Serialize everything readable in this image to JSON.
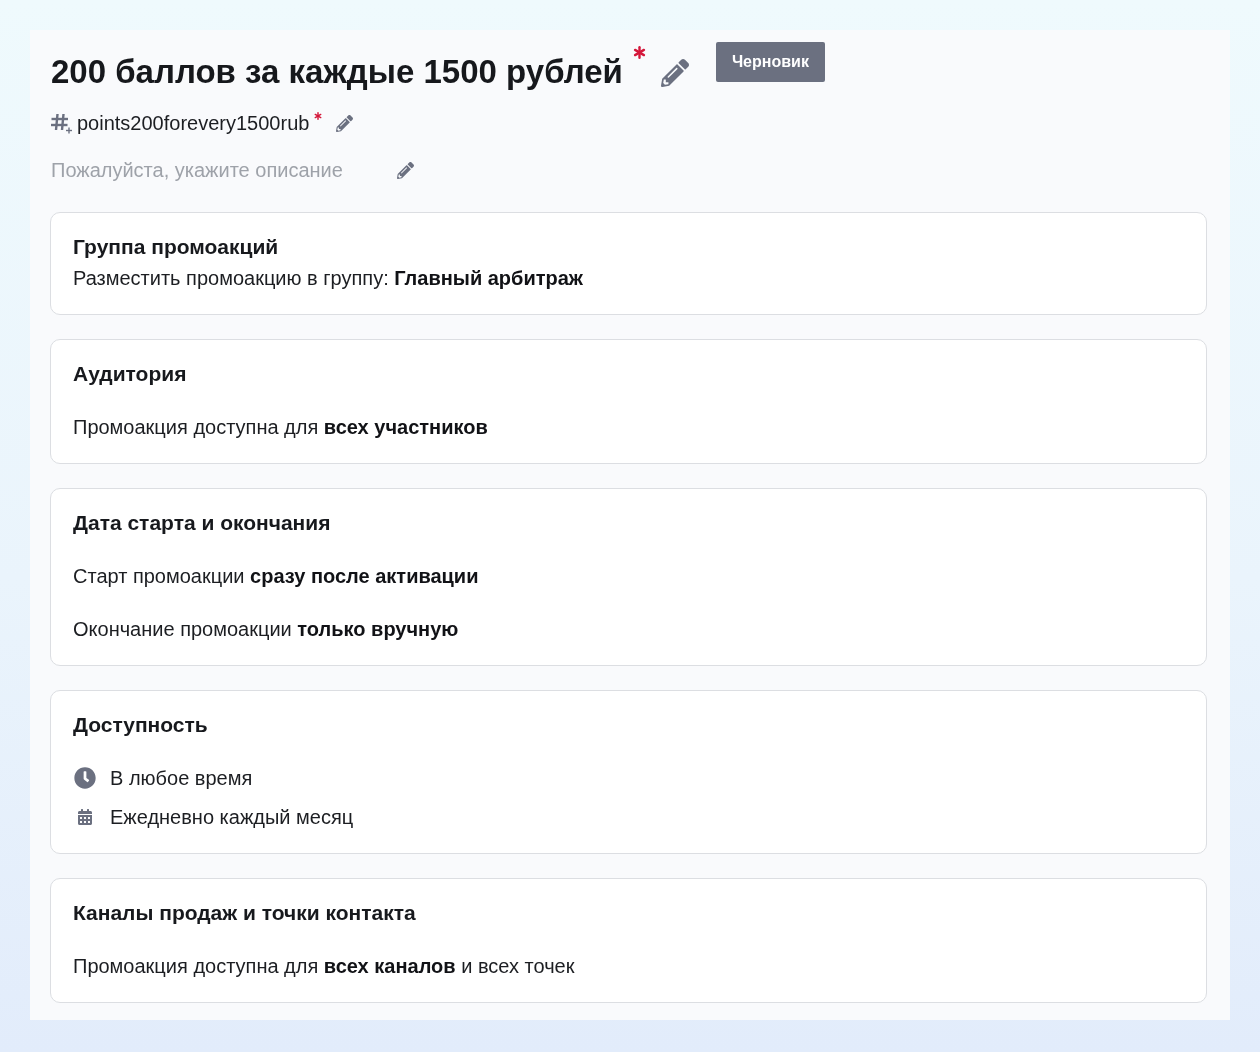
{
  "header": {
    "title": {
      "text": "200 баллов за каждые 1500 рублей",
      "required": true
    },
    "status": "Черновик",
    "code": {
      "text": "points200forevery1500rub",
      "required": true
    },
    "description": {
      "placeholder": "Пожалуйста, укажите описание"
    }
  },
  "sections": [
    {
      "kind": "caption",
      "title": "Группа промоакций",
      "lines": [
        "Разместить промоакцию в группу: **Главный арбитраж**"
      ]
    },
    {
      "kind": "text",
      "title": "Аудитория",
      "lines": [
        "Промоакция доступна для **всех участников**"
      ]
    },
    {
      "kind": "text",
      "title": "Дата старта и окончания",
      "lines": [
        "Старт промоакции **сразу после активации**",
        "Окончание промоакции **только вручную**"
      ]
    },
    {
      "kind": "icons",
      "title": "Доступность",
      "items": [
        {
          "kind": "time",
          "text": "В любое время"
        },
        {
          "kind": "date",
          "text": "Ежедневно каждый месяц"
        }
      ]
    },
    {
      "kind": "text",
      "title": "Каналы продаж и точки контакта",
      "lines": [
        "Промоакция доступна для **всех каналов** и всех точек"
      ]
    }
  ]
}
